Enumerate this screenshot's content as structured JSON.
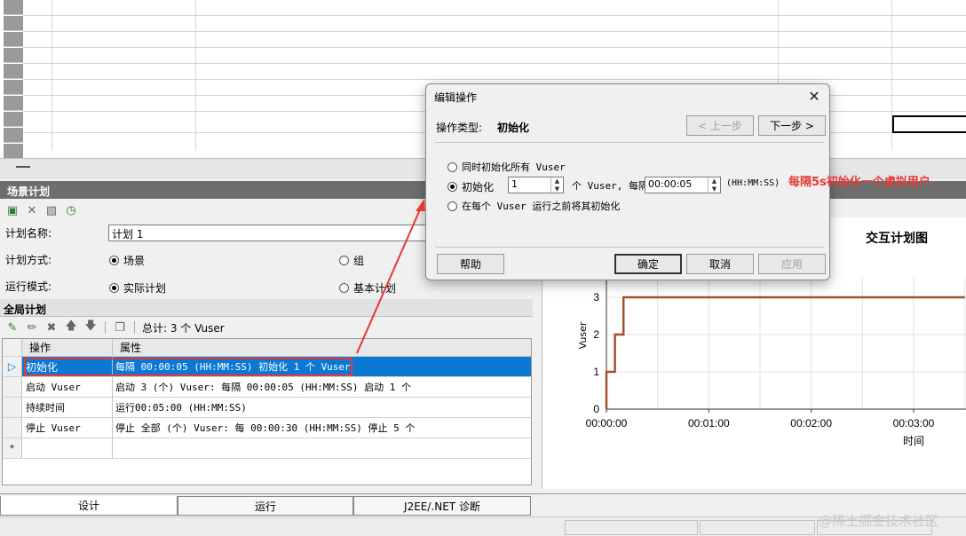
{
  "colors": {
    "accent": "#0b78d4",
    "annotation": "#e53935",
    "series": "#a0522d"
  },
  "schedule": {
    "header": "场景计划",
    "plan_name_label": "计划名称:",
    "plan_name_value": "计划 1",
    "plan_mode_label": "计划方式:",
    "plan_mode_opt1": "场景",
    "plan_mode_opt2": "组",
    "run_mode_label": "运行模式:",
    "run_mode_opt1": "实际计划",
    "run_mode_opt2": "基本计划"
  },
  "global": {
    "header": "全局计划",
    "total": "总计: 3 个 Vuser",
    "columns": [
      "操作",
      "属性"
    ],
    "rows": [
      {
        "op": "初始化",
        "prop": "每隔 00:00:05 (HH:MM:SS) 初始化 1 个 Vuser"
      },
      {
        "op": "启动 Vuser",
        "prop": "启动 3 (个) Vuser: 每隔 00:00:05 (HH:MM:SS) 启动 1 个"
      },
      {
        "op": "持续时间",
        "prop": "运行00:05:00 (HH:MM:SS)"
      },
      {
        "op": "停止 Vuser",
        "prop": "停止 全部 (个) Vuser: 每 00:00:30 (HH:MM:SS) 停止 5 个"
      }
    ],
    "new_row_marker": "*"
  },
  "tabs": {
    "design": "设计",
    "run": "运行",
    "j2ee": "J2EE/.NET 诊断"
  },
  "dialog": {
    "title": "编辑操作",
    "type_label": "操作类型:",
    "type_value": "初始化",
    "prev": "< 上一步",
    "next": "下一步 >",
    "opt1": "同时初始化所有 Vuser",
    "opt2": "初始化",
    "opt2_count": "1",
    "opt2_mid": "个 Vuser, 每隔",
    "opt2_time": "00:00:05",
    "opt2_unit": "(HH:MM:SS)",
    "opt3": "在每个 Vuser 运行之前将其初始化",
    "help": "帮助",
    "ok": "确定",
    "cancel": "取消",
    "apply": "应用"
  },
  "annotation": "每隔5s初始化一个虚拟用户",
  "watermark": "@稀土掘金技术社区",
  "chart_data": {
    "type": "line",
    "title": "交互计划图",
    "xlabel": "时间",
    "ylabel": "Vuser",
    "x_ticks": [
      "00:00:00",
      "00:01:00",
      "00:02:00",
      "00:03:00"
    ],
    "y_ticks": [
      0,
      1,
      2,
      3
    ],
    "ylim": [
      0,
      3
    ],
    "grid": true,
    "series": [
      {
        "x": [
          "00:00:00",
          "00:00:00",
          "00:00:05",
          "00:00:05",
          "00:00:10",
          "00:00:10",
          "00:03:30"
        ],
        "y": [
          0,
          1,
          1,
          2,
          2,
          3,
          3
        ]
      }
    ]
  }
}
